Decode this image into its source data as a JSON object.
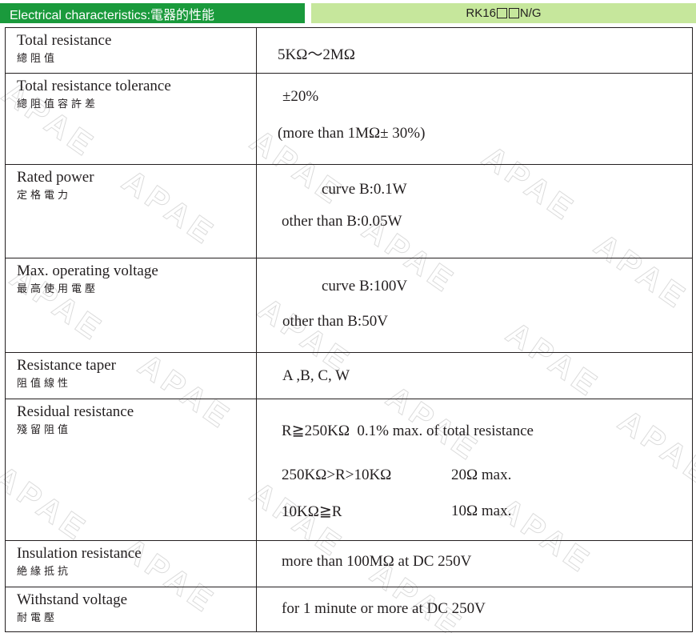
{
  "header": {
    "left_title": "Electrical characteristics:電器的性能",
    "right_model_prefix": "RK16",
    "right_model_suffix": "N/G"
  },
  "watermark": {
    "text": "APAE"
  },
  "rows": [
    {
      "label_en": "Total resistance",
      "label_zh": "總阻值",
      "values": [
        "5KΩ～2MΩ"
      ]
    },
    {
      "label_en": "Total resistance tolerance",
      "label_zh": "總阻值容許差",
      "values": [
        "±20%",
        "(more than 1MΩ± 30%)"
      ]
    },
    {
      "label_en": "Rated power",
      "label_zh": "定格電力",
      "values": [
        "curve B:0.1W",
        "other than B:0.05W"
      ]
    },
    {
      "label_en": "Max. operating voltage",
      "label_zh": "最高使用電壓",
      "values": [
        "curve B:100V",
        "other than B:50V"
      ]
    },
    {
      "label_en": "Resistance taper",
      "label_zh": "阻值線性",
      "values": [
        "A ,B, C, W"
      ]
    },
    {
      "label_en": "Residual resistance",
      "label_zh": "殘留阻值",
      "values": [
        "R≧250KΩ  0.1% max. of total resistance",
        "250KΩ>R>10KΩ",
        "20Ω max.",
        "10KΩ≧R",
        "10Ω max."
      ]
    },
    {
      "label_en": "Insulation resistance",
      "label_zh": "絶緣抵抗",
      "values": [
        "more than 100MΩ at DC 250V"
      ]
    },
    {
      "label_en": "Withstand voltage",
      "label_zh": "耐電壓",
      "values": [
        "for 1 minute or more at DC 250V"
      ]
    }
  ]
}
